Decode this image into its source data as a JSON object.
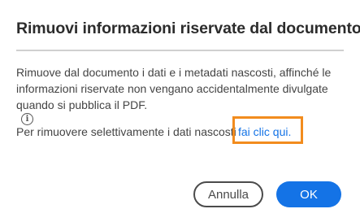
{
  "dialog": {
    "title": "Rimuovi informazioni riservate dal documento",
    "description_lines": [
      "Rimuove dal documento i dati e i metadati nascosti, affinché le",
      "informazioni riservate non vengano accidentalmente divulgate",
      "quando si pubblica il PDF."
    ],
    "info_icon": "info-circle-icon",
    "selective_text": "Per rimuovere selettivamente i dati nascosti,",
    "selective_link": "fai clic qui.",
    "highlight_color": "#f28c1e",
    "accent_color": "#1473e6",
    "buttons": {
      "cancel": "Annulla",
      "ok": "OK"
    }
  }
}
